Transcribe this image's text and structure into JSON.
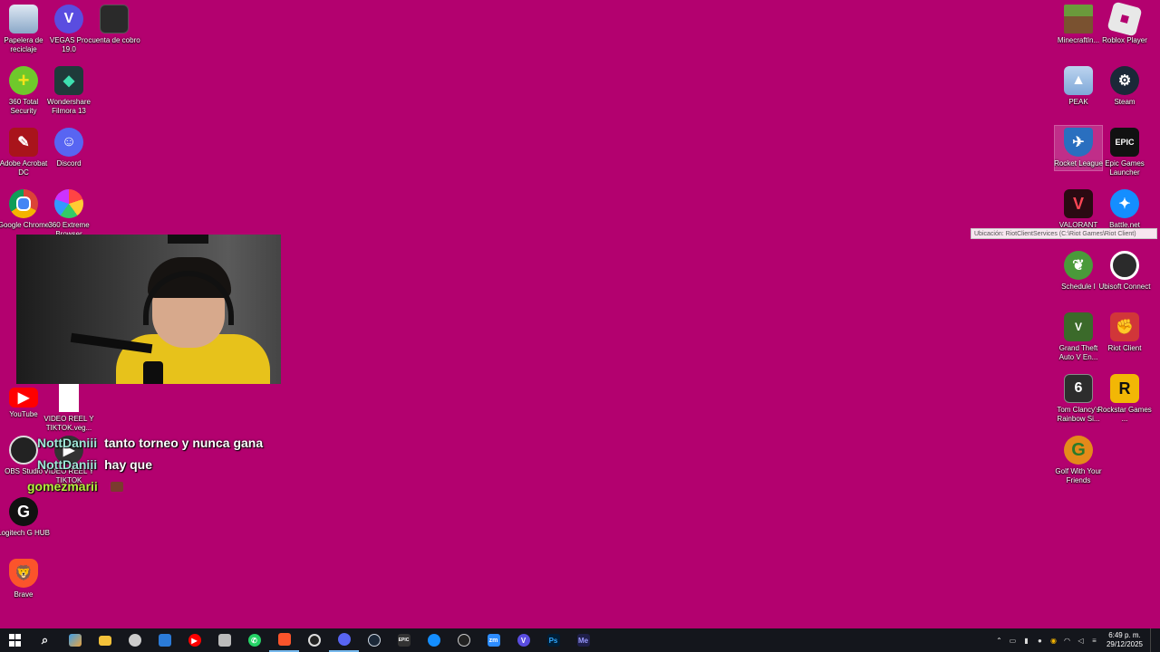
{
  "desktop": {
    "icons_left": [
      {
        "label": "Papelera de reciclaje",
        "icon": "recycle-bin-icon",
        "color": "#8aa8c8"
      },
      {
        "label": "VEGAS Pro 19.0",
        "icon": "vegas-icon",
        "color": "#5a4de0",
        "glyph": "V"
      },
      {
        "label": "cuenta de cobro",
        "icon": "document-icon",
        "color": "#2a2a2a"
      },
      {
        "label": "360 Total Security",
        "icon": "shield-plus-icon",
        "color": "#6fc92b",
        "glyph": "+"
      },
      {
        "label": "Wondershare Filmora 13",
        "icon": "filmora-icon",
        "color": "#1f3a3a"
      },
      {
        "label": "Adobe Acrobat DC",
        "icon": "acrobat-icon",
        "color": "#a9141b"
      },
      {
        "label": "Discord",
        "icon": "discord-icon",
        "color": "#5865f2"
      },
      {
        "label": "Google Chrome",
        "icon": "chrome-icon",
        "color": "#e8b422"
      },
      {
        "label": "360 Extreme Browser",
        "icon": "browser-icon",
        "color": "#d94fa3"
      },
      {
        "label": "YouTube",
        "icon": "youtube-icon",
        "color": "#ff0000"
      },
      {
        "label": "VIDEO REEL Y TIKTOK.veg...",
        "icon": "file-icon",
        "color": "#ffffff"
      },
      {
        "label": "OBS Studio",
        "icon": "obs-icon",
        "color": "#222222"
      },
      {
        "label": "VIDEO REEL Y TIKTOK",
        "icon": "video-icon",
        "color": "#333333"
      },
      {
        "label": "Logitech G HUB",
        "icon": "logitech-icon",
        "color": "#111111",
        "glyph": "G"
      },
      {
        "label": "Brave",
        "icon": "brave-icon",
        "color": "#fb542b"
      }
    ],
    "icons_right": [
      {
        "label": "MinecraftIn...",
        "icon": "minecraft-icon",
        "color": "#6a9a3b"
      },
      {
        "label": "Roblox Player",
        "icon": "roblox-icon",
        "color": "#e8e8e8"
      },
      {
        "label": "PEAK",
        "icon": "peak-icon",
        "color": "#7fa8d8"
      },
      {
        "label": "Steam",
        "icon": "steam-icon",
        "color": "#1b2838"
      },
      {
        "label": "Rocket League",
        "icon": "rocket-league-icon",
        "color": "#2a6fbf"
      },
      {
        "label": "Epic Games Launcher",
        "icon": "epic-icon",
        "color": "#111111",
        "glyph": "EPIC"
      },
      {
        "label": "VALORANT",
        "icon": "valorant-icon",
        "color": "#2a0a12",
        "glyph": "V"
      },
      {
        "label": "Battle.net",
        "icon": "battlenet-icon",
        "color": "#148eff"
      },
      {
        "label": "Schedule I",
        "icon": "schedule-icon",
        "color": "#4a9a3a"
      },
      {
        "label": "Ubisoft Connect",
        "icon": "ubisoft-icon",
        "color": "#2b2b2b"
      },
      {
        "label": "Grand Theft Auto V En...",
        "icon": "gta-icon",
        "color": "#3b6a2a"
      },
      {
        "label": "Riot Client",
        "icon": "riot-icon",
        "color": "#d13639"
      },
      {
        "label": "Tom Clancy's Rainbow Si...",
        "icon": "rainbow-six-icon",
        "color": "#2d2d2d"
      },
      {
        "label": "Rockstar Games ...",
        "icon": "rockstar-icon",
        "color": "#f2b705",
        "glyph": "R"
      },
      {
        "label": "Golf With Your Friends",
        "icon": "golf-icon",
        "color": "#e48a1a",
        "glyph": "G"
      }
    ],
    "tooltip": "Ubicación: RiotClientServices (C:\\Riot Games\\Riot Client)"
  },
  "chat": [
    {
      "user": "NottDaniii",
      "text": "tanto torneo y nunca gana",
      "user_color": "#9fe6d7"
    },
    {
      "user": "NottDaniii",
      "text": "hay que",
      "user_color": "#9fe6d7"
    },
    {
      "user": "gomezmarii",
      "text": "",
      "user_color": "#b5f03c",
      "emote": true
    }
  ],
  "taskbar": {
    "apps": [
      {
        "name": "start-button",
        "icon": "windows-icon",
        "color": "#ffffff"
      },
      {
        "name": "search-button",
        "icon": "search-icon",
        "color": "#ffffff"
      },
      {
        "name": "taskbar-copilot",
        "icon": "copilot-icon",
        "color": "#3fa0e8"
      },
      {
        "name": "taskbar-explorer",
        "icon": "folder-icon",
        "color": "#f3c13a"
      },
      {
        "name": "taskbar-app-5",
        "icon": "app-icon",
        "color": "#cccccc"
      },
      {
        "name": "taskbar-store",
        "icon": "store-icon",
        "color": "#2b7bd8"
      },
      {
        "name": "taskbar-youtube",
        "icon": "youtube-icon",
        "color": "#ff0000"
      },
      {
        "name": "taskbar-app-8",
        "icon": "app-icon",
        "color": "#bbbbbb"
      },
      {
        "name": "taskbar-whatsapp",
        "icon": "whatsapp-icon",
        "color": "#25d366"
      },
      {
        "name": "taskbar-brave",
        "icon": "brave-icon",
        "color": "#fb542b"
      },
      {
        "name": "taskbar-obs",
        "icon": "obs-icon",
        "color": "#dddddd"
      },
      {
        "name": "taskbar-discord",
        "icon": "discord-icon",
        "color": "#5865f2"
      },
      {
        "name": "taskbar-steam",
        "icon": "steam-icon",
        "color": "#cfd8e3"
      },
      {
        "name": "taskbar-epic",
        "icon": "epic-icon",
        "color": "#dddddd",
        "glyph": "EPIC"
      },
      {
        "name": "taskbar-battlenet",
        "icon": "battlenet-icon",
        "color": "#148eff"
      },
      {
        "name": "taskbar-app-16",
        "icon": "app-icon",
        "color": "#cccccc"
      },
      {
        "name": "taskbar-zoom",
        "icon": "zoom-icon",
        "color": "#2d8cff",
        "glyph": "zm"
      },
      {
        "name": "taskbar-vegas",
        "icon": "vegas-icon",
        "color": "#5a4de0",
        "glyph": "V"
      },
      {
        "name": "taskbar-photoshop",
        "icon": "photoshop-icon",
        "color": "#001e36",
        "glyph": "Ps"
      },
      {
        "name": "taskbar-media-encoder",
        "icon": "media-encoder-icon",
        "color": "#1f1f4a",
        "glyph": "Me"
      }
    ],
    "time": "6:49 p. m.",
    "date": "29/12/2025"
  }
}
